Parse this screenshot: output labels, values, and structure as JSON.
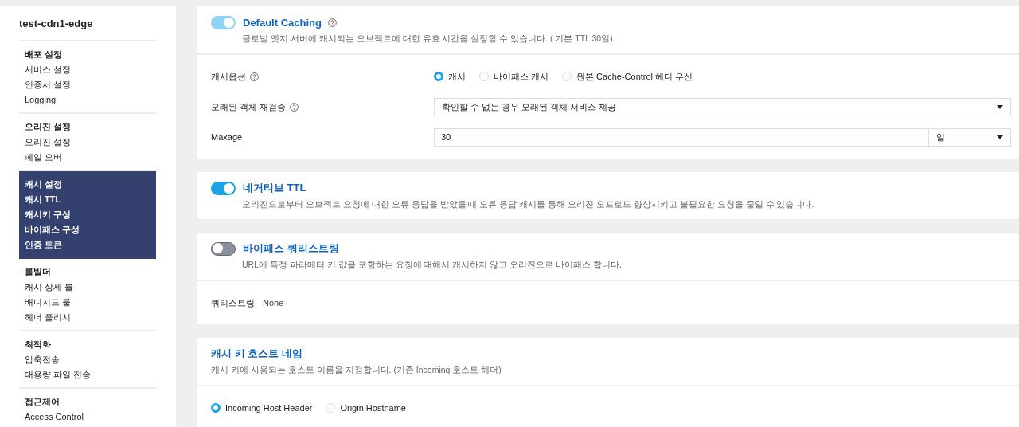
{
  "sidebar": {
    "title": "test-cdn1-edge",
    "groups": [
      {
        "heading": "배포 설정",
        "selected": false,
        "items": [
          "서비스 설정",
          "인증서 설정",
          "Logging"
        ]
      },
      {
        "heading": "오리진 설정",
        "selected": false,
        "items": [
          "오리진 설정",
          "페일 오버"
        ]
      },
      {
        "heading": "캐시 설정",
        "selected": true,
        "items": [
          "캐시 TTL",
          "캐시키 구성",
          "바이패스 구성",
          "인증 토큰"
        ]
      },
      {
        "heading": "룰빌더",
        "selected": false,
        "items": [
          "캐시 상세 룰",
          "배니지드 룰",
          "헤더 폴리시"
        ]
      },
      {
        "heading": "최적화",
        "selected": false,
        "items": [
          "압축전송",
          "대용량 파일 전송"
        ]
      },
      {
        "heading": "접근제어",
        "selected": false,
        "items": [
          "Access Control"
        ]
      }
    ]
  },
  "sections": [
    {
      "title": "Default Caching",
      "help": true,
      "toggle": {
        "on": true,
        "disabled": true
      },
      "description": "글로벌 엣지 서버에 캐시되는 오브젝트에 대한 유효 시간을 설정할 수 있습니다. ( 기본 TTL 30일)",
      "rows": [
        {
          "kind": "radio",
          "label": "캐시옵션",
          "help": true,
          "options": [
            {
              "label": "캐시",
              "selected": true
            },
            {
              "label": "바이패스 캐시",
              "selected": false
            },
            {
              "label": "원본 Cache-Control 헤더 우선",
              "selected": false
            }
          ]
        },
        {
          "kind": "select",
          "label": "오래된 객체 재검증",
          "help": true,
          "value": "확인할 수 없는 경우 오래된 객체 서비스 제공"
        },
        {
          "kind": "number_unit",
          "label": "Maxage",
          "help": false,
          "value": "30",
          "unit": "일"
        }
      ]
    },
    {
      "title": "네거티브 TTL",
      "help": false,
      "toggle": {
        "on": true,
        "disabled": false
      },
      "description": "오리진으로부터 오브젝트 요청에 대한 오류 응답을 받았을 때 오류 응답 캐시를 통해 오리진 오프로드 향상시키고 불필요한 요청을 줄일 수 있습니다."
    },
    {
      "title": "바이패스 쿼리스트링",
      "help": false,
      "toggle": {
        "on": false,
        "disabled": false
      },
      "description": "URL에 특정 파라메터 키 값을 포함하는 요청에 대해서 캐시하지 않고 오리진으로 바이패스 합니다.",
      "rows": [
        {
          "kind": "text",
          "label": "쿼리스트링",
          "value": "None"
        }
      ]
    },
    {
      "title": "캐시 키 호스트 네임",
      "help": false,
      "description": "캐시 키에 사용되는 호스트 이름을 지정합니다. (기존 Incoming 호스트 헤더)",
      "rows": [
        {
          "kind": "radio",
          "options": [
            {
              "label": "Incoming Host Header",
              "selected": true
            },
            {
              "label": "Origin Hostname",
              "selected": false
            }
          ]
        }
      ]
    }
  ]
}
